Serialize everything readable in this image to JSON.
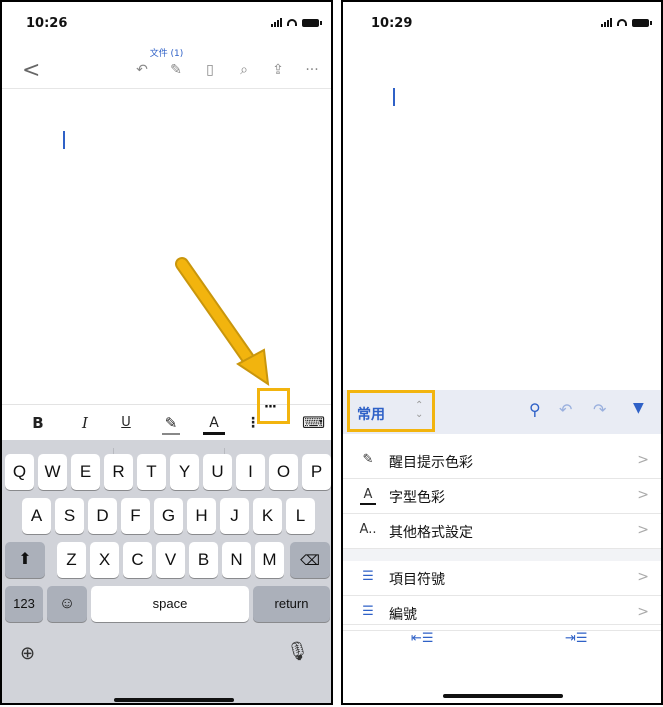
{
  "left": {
    "status": {
      "time": "10:26"
    },
    "header": {
      "doc_title": "文件 (1)",
      "back_icon": "chevron-left-icon",
      "tools": [
        "undo-icon",
        "draw-icon",
        "mobile-view-icon",
        "search-icon",
        "share-icon",
        "more-icon"
      ]
    },
    "format_bar": {
      "bold": "B",
      "italic": "I",
      "underline": "U",
      "highlight": "highlight-icon",
      "font_color": "A",
      "more": "···",
      "keyboard": "keyboard-icon"
    },
    "keyboard": {
      "row1": [
        "Q",
        "W",
        "E",
        "R",
        "T",
        "Y",
        "U",
        "I",
        "O",
        "P"
      ],
      "row2": [
        "A",
        "S",
        "D",
        "F",
        "G",
        "H",
        "J",
        "K",
        "L"
      ],
      "row3": [
        "Z",
        "X",
        "C",
        "V",
        "B",
        "N",
        "M"
      ],
      "numbers_label": "123",
      "space_label": "space",
      "return_label": "return"
    },
    "highlight_color": "#f2b40e"
  },
  "right": {
    "status": {
      "time": "10:29"
    },
    "ribbon": {
      "tab_label": "常用"
    },
    "menu": [
      {
        "icon": "highlight-icon",
        "label": "醒目提示色彩"
      },
      {
        "icon": "font-color-icon",
        "label": "字型色彩"
      },
      {
        "icon": "more-format-icon",
        "label": "其他格式設定"
      },
      {
        "icon": "bullets-icon",
        "label": "項目符號"
      },
      {
        "icon": "numbering-icon",
        "label": "編號"
      }
    ],
    "accent_color": "#2f61c7"
  }
}
